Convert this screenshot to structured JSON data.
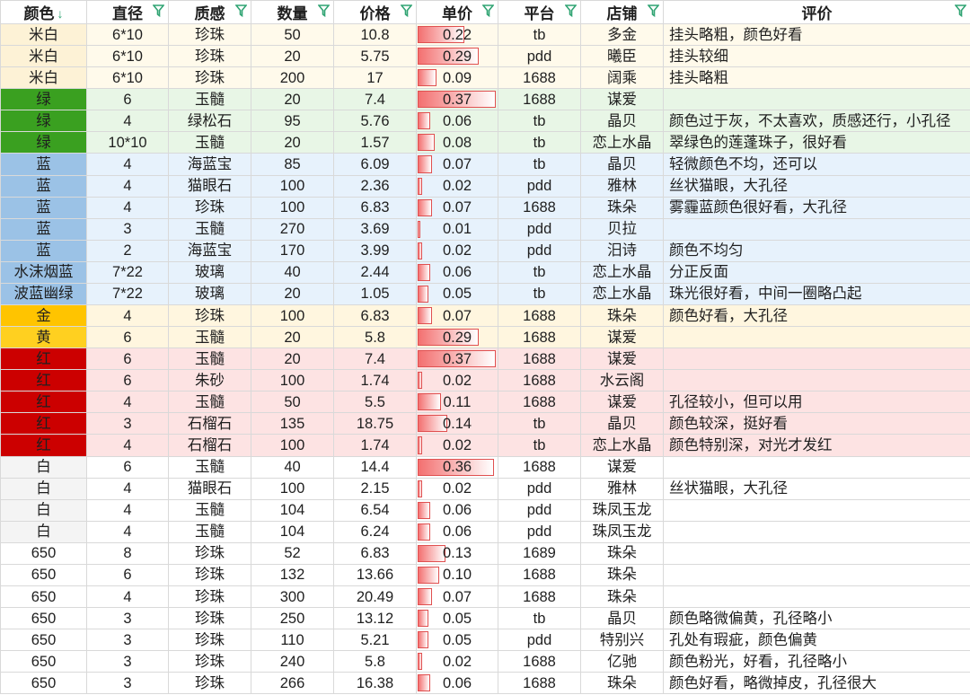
{
  "colors": {
    "miBai": "#fdf2d6",
    "green": "#3aa020",
    "blue": "#9bc2e6",
    "gold": "#ffc400",
    "red": "#cc0000",
    "white": "#f4f4f4",
    "c650": "#ffffff",
    "rowMiBai": "#fffaeb",
    "rowGreen": "#e8f6e6",
    "rowBlue": "#e7f2fc",
    "rowGold": "#fff6df",
    "rowRed": "#fde3e3",
    "rowWhite": "#ffffff",
    "accent": "#2fa372"
  },
  "headers": [
    "颜色",
    "直径",
    "质感",
    "数量",
    "价格",
    "单价",
    "平台",
    "店铺",
    "评价"
  ],
  "rows": [
    {
      "color": "米白",
      "diameter": "6*10",
      "texture": "珍珠",
      "qty": "50",
      "price": "10.8",
      "unit": "0.22",
      "platform": "tb",
      "shop": "多金",
      "review": "挂头略粗，颜色好看",
      "group": "miBai"
    },
    {
      "color": "米白",
      "diameter": "6*10",
      "texture": "珍珠",
      "qty": "20",
      "price": "5.75",
      "unit": "0.29",
      "platform": "pdd",
      "shop": "曦臣",
      "review": "挂头较细",
      "group": "miBai"
    },
    {
      "color": "米白",
      "diameter": "6*10",
      "texture": "珍珠",
      "qty": "200",
      "price": "17",
      "unit": "0.09",
      "platform": "1688",
      "shop": "阔乘",
      "review": "挂头略粗",
      "group": "miBai"
    },
    {
      "color": "绿",
      "diameter": "6",
      "texture": "玉髓",
      "qty": "20",
      "price": "7.4",
      "unit": "0.37",
      "platform": "1688",
      "shop": "谋爱",
      "review": "",
      "group": "green"
    },
    {
      "color": "绿",
      "diameter": "4",
      "texture": "绿松石",
      "qty": "95",
      "price": "5.76",
      "unit": "0.06",
      "platform": "tb",
      "shop": "晶贝",
      "review": "颜色过于灰，不太喜欢，质感还行，小孔径",
      "group": "green"
    },
    {
      "color": "绿",
      "diameter": "10*10",
      "texture": "玉髓",
      "qty": "20",
      "price": "1.57",
      "unit": "0.08",
      "platform": "tb",
      "shop": "恋上水晶",
      "review": "翠绿色的莲蓬珠子，很好看",
      "group": "green"
    },
    {
      "color": "蓝",
      "diameter": "4",
      "texture": "海蓝宝",
      "qty": "85",
      "price": "6.09",
      "unit": "0.07",
      "platform": "tb",
      "shop": "晶贝",
      "review": "轻微颜色不均，还可以",
      "group": "blue"
    },
    {
      "color": "蓝",
      "diameter": "4",
      "texture": "猫眼石",
      "qty": "100",
      "price": "2.36",
      "unit": "0.02",
      "platform": "pdd",
      "shop": "雅林",
      "review": "丝状猫眼，大孔径",
      "group": "blue"
    },
    {
      "color": "蓝",
      "diameter": "4",
      "texture": "珍珠",
      "qty": "100",
      "price": "6.83",
      "unit": "0.07",
      "platform": "1688",
      "shop": "珠朵",
      "review": "雾霾蓝颜色很好看，大孔径",
      "group": "blue"
    },
    {
      "color": "蓝",
      "diameter": "3",
      "texture": "玉髓",
      "qty": "270",
      "price": "3.69",
      "unit": "0.01",
      "platform": "pdd",
      "shop": "贝拉",
      "review": "",
      "group": "blue"
    },
    {
      "color": "蓝",
      "diameter": "2",
      "texture": "海蓝宝",
      "qty": "170",
      "price": "3.99",
      "unit": "0.02",
      "platform": "pdd",
      "shop": "汨诗",
      "review": "颜色不均匀",
      "group": "blue"
    },
    {
      "color": "水沫烟蓝",
      "diameter": "7*22",
      "texture": "玻璃",
      "qty": "40",
      "price": "2.44",
      "unit": "0.06",
      "platform": "tb",
      "shop": "恋上水晶",
      "review": "分正反面",
      "group": "blue"
    },
    {
      "color": "波蓝幽绿",
      "diameter": "7*22",
      "texture": "玻璃",
      "qty": "20",
      "price": "1.05",
      "unit": "0.05",
      "platform": "tb",
      "shop": "恋上水晶",
      "review": "珠光很好看，中间一圈略凸起",
      "group": "blue"
    },
    {
      "color": "金",
      "diameter": "4",
      "texture": "珍珠",
      "qty": "100",
      "price": "6.83",
      "unit": "0.07",
      "platform": "1688",
      "shop": "珠朵",
      "review": "颜色好看，大孔径",
      "group": "gold"
    },
    {
      "color": "黄",
      "diameter": "6",
      "texture": "玉髓",
      "qty": "20",
      "price": "5.8",
      "unit": "0.29",
      "platform": "1688",
      "shop": "谋爱",
      "review": "",
      "group": "gold"
    },
    {
      "color": "红",
      "diameter": "6",
      "texture": "玉髓",
      "qty": "20",
      "price": "7.4",
      "unit": "0.37",
      "platform": "1688",
      "shop": "谋爱",
      "review": "",
      "group": "red"
    },
    {
      "color": "红",
      "diameter": "6",
      "texture": "朱砂",
      "qty": "100",
      "price": "1.74",
      "unit": "0.02",
      "platform": "1688",
      "shop": "水云阁",
      "review": "",
      "group": "red"
    },
    {
      "color": "红",
      "diameter": "4",
      "texture": "玉髓",
      "qty": "50",
      "price": "5.5",
      "unit": "0.11",
      "platform": "1688",
      "shop": "谋爱",
      "review": "孔径较小，但可以用",
      "group": "red"
    },
    {
      "color": "红",
      "diameter": "3",
      "texture": "石榴石",
      "qty": "135",
      "price": "18.75",
      "unit": "0.14",
      "platform": "tb",
      "shop": "晶贝",
      "review": "颜色较深，挺好看",
      "group": "red"
    },
    {
      "color": "红",
      "diameter": "4",
      "texture": "石榴石",
      "qty": "100",
      "price": "1.74",
      "unit": "0.02",
      "platform": "tb",
      "shop": "恋上水晶",
      "review": "颜色特别深，对光才发红",
      "group": "red"
    },
    {
      "color": "白",
      "diameter": "6",
      "texture": "玉髓",
      "qty": "40",
      "price": "14.4",
      "unit": "0.36",
      "platform": "1688",
      "shop": "谋爱",
      "review": "",
      "group": "white"
    },
    {
      "color": "白",
      "diameter": "4",
      "texture": "猫眼石",
      "qty": "100",
      "price": "2.15",
      "unit": "0.02",
      "platform": "pdd",
      "shop": "雅林",
      "review": "丝状猫眼，大孔径",
      "group": "white"
    },
    {
      "color": "白",
      "diameter": "4",
      "texture": "玉髓",
      "qty": "104",
      "price": "6.54",
      "unit": "0.06",
      "platform": "pdd",
      "shop": "珠凤玉龙",
      "review": "",
      "group": "white"
    },
    {
      "color": "白",
      "diameter": "4",
      "texture": "玉髓",
      "qty": "104",
      "price": "6.24",
      "unit": "0.06",
      "platform": "pdd",
      "shop": "珠凤玉龙",
      "review": "",
      "group": "white"
    },
    {
      "color": "650",
      "diameter": "8",
      "texture": "珍珠",
      "qty": "52",
      "price": "6.83",
      "unit": "0.13",
      "platform": "1689",
      "shop": "珠朵",
      "review": "",
      "group": "c650"
    },
    {
      "color": "650",
      "diameter": "6",
      "texture": "珍珠",
      "qty": "132",
      "price": "13.66",
      "unit": "0.10",
      "platform": "1688",
      "shop": "珠朵",
      "review": "",
      "group": "c650"
    },
    {
      "color": "650",
      "diameter": "4",
      "texture": "珍珠",
      "qty": "300",
      "price": "20.49",
      "unit": "0.07",
      "platform": "1688",
      "shop": "珠朵",
      "review": "",
      "group": "c650"
    },
    {
      "color": "650",
      "diameter": "3",
      "texture": "珍珠",
      "qty": "250",
      "price": "13.12",
      "unit": "0.05",
      "platform": "tb",
      "shop": "晶贝",
      "review": "颜色略微偏黄，孔径略小",
      "group": "c650"
    },
    {
      "color": "650",
      "diameter": "3",
      "texture": "珍珠",
      "qty": "110",
      "price": "5.21",
      "unit": "0.05",
      "platform": "pdd",
      "shop": "特别兴",
      "review": "孔处有瑕疵，颜色偏黄",
      "group": "c650"
    },
    {
      "color": "650",
      "diameter": "3",
      "texture": "珍珠",
      "qty": "240",
      "price": "5.8",
      "unit": "0.02",
      "platform": "1688",
      "shop": "亿驰",
      "review": "颜色粉光，好看，孔径略小",
      "group": "c650"
    },
    {
      "color": "650",
      "diameter": "3",
      "texture": "珍珠",
      "qty": "266",
      "price": "16.38",
      "unit": "0.06",
      "platform": "1688",
      "shop": "珠朵",
      "review": "颜色好看，略微掉皮，孔径很大",
      "group": "c650"
    }
  ]
}
